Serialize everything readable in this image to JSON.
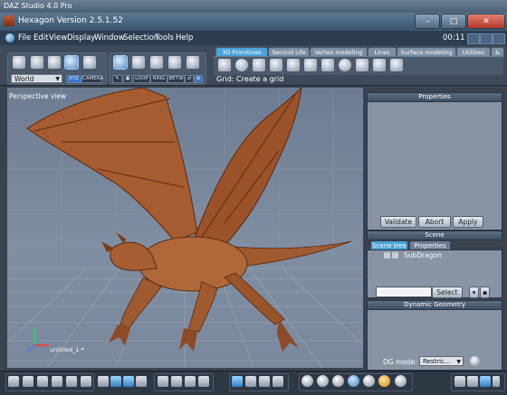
{
  "outer_window": {
    "title": "DAZ Studio 4.0 Pro"
  },
  "app_window": {
    "title": "Hexagon Version 2.5.1.52",
    "minimize_label": "–",
    "maximize_label": "□",
    "close_label": "✕"
  },
  "menu": {
    "items": [
      "File",
      "Edit",
      "View",
      "Display",
      "Window",
      "Selection",
      "Tools",
      "Help"
    ],
    "clock": "00:11"
  },
  "toolbar": {
    "coord_space": "World",
    "xyz_label": "XYZ",
    "camera_label": "CAMERA",
    "selection_modes": [
      "LOOP",
      "RING",
      "BETW"
    ]
  },
  "palette_tabs": [
    "3D Primitives",
    "Second Life",
    "Vertex modeling",
    "Lines",
    "Surface modeling",
    "Utilities",
    "&"
  ],
  "active_palette_tab": "3D Primitives",
  "hint_text": "Grid: Create a grid",
  "viewport": {
    "label": "Perspective view",
    "object_label": "untitled_1 *"
  },
  "properties_panel": {
    "title": "Properties",
    "buttons": [
      "Validate",
      "Abort",
      "Apply"
    ]
  },
  "scene_panel": {
    "title": "Scene",
    "tabs": [
      "Scene tree",
      "Properties"
    ],
    "active_tab": "Scene tree",
    "items": [
      "SubDragon"
    ],
    "select_button": "Select"
  },
  "dynamic_geometry_panel": {
    "title": "Dynamic Geometry",
    "dg_mode_label": "DG mode:",
    "dg_mode_value": "Restric..."
  },
  "colors": {
    "accent": "#4aa3d8",
    "dragon": "#a0562e",
    "viewport_bg": "#7a889d"
  }
}
